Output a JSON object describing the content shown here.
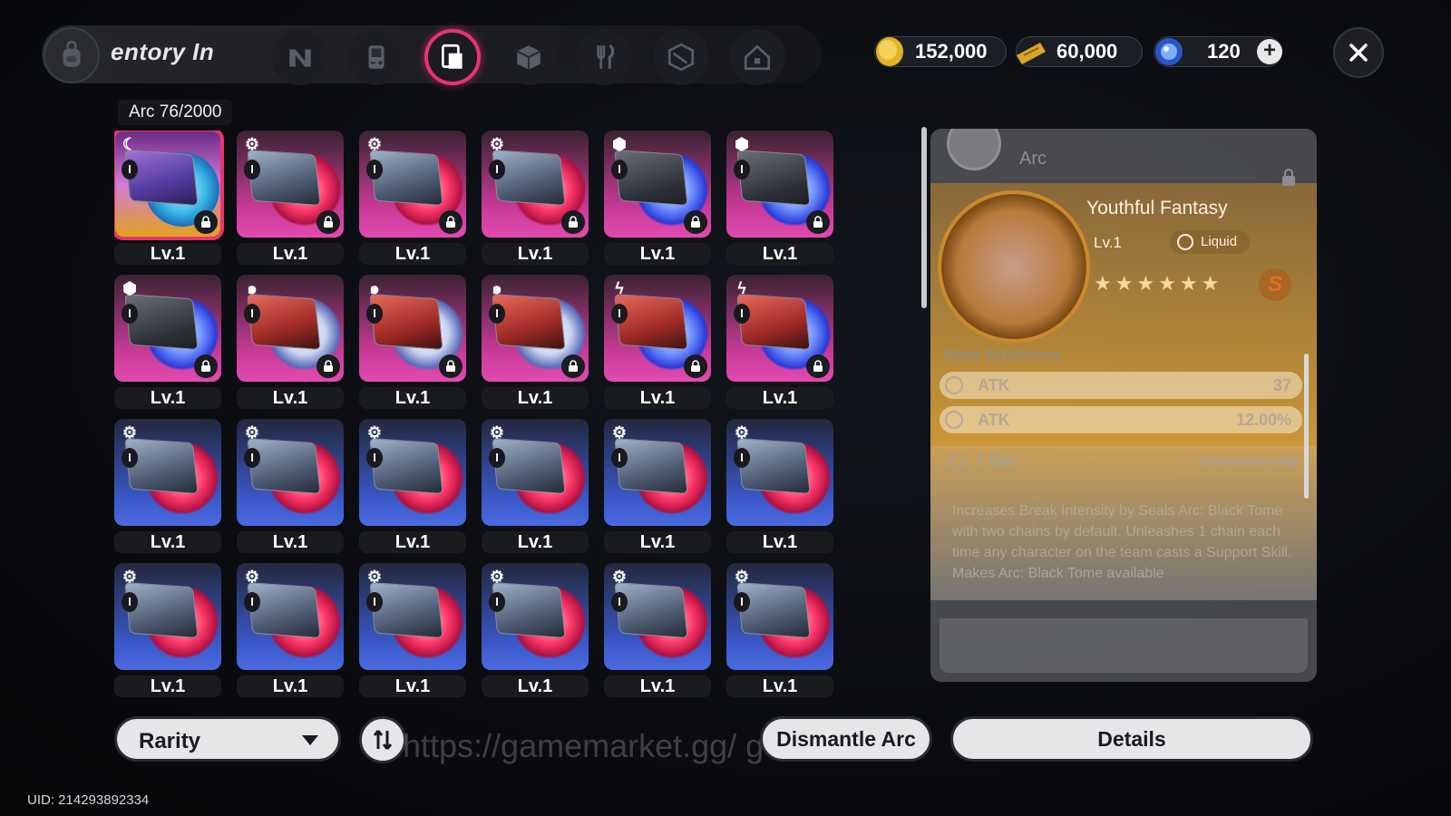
{
  "header": {
    "title": "entory  In",
    "tabs": [
      {
        "icon": "n-logo-icon",
        "active": false
      },
      {
        "icon": "handheld-console-icon",
        "active": false
      },
      {
        "icon": "arc-card-icon",
        "active": true
      },
      {
        "icon": "cube-icon",
        "active": false
      },
      {
        "icon": "fork-knife-icon",
        "active": false
      },
      {
        "icon": "box-open-icon",
        "active": false
      },
      {
        "icon": "house-icon",
        "active": false
      }
    ]
  },
  "currencies": [
    {
      "icon": "gold-coin-icon",
      "value": "152,000"
    },
    {
      "icon": "ticket-icon",
      "value": "60,000"
    },
    {
      "icon": "crystal-icon",
      "value": "120"
    }
  ],
  "inventory": {
    "category_count": "Arc 76/2000",
    "items": [
      {
        "lv": "Lv.1",
        "rarity": "gold",
        "art": "purple",
        "type": "wind-icon",
        "tier": "I",
        "locked": true,
        "selected": true
      },
      {
        "lv": "Lv.1",
        "rarity": "pink",
        "art": "slate",
        "type": "gear-icon",
        "tier": "I",
        "locked": true
      },
      {
        "lv": "Lv.1",
        "rarity": "pink",
        "art": "slate",
        "type": "gear-icon",
        "tier": "I",
        "locked": true
      },
      {
        "lv": "Lv.1",
        "rarity": "pink",
        "art": "slate",
        "type": "gear-icon",
        "tier": "I",
        "locked": true
      },
      {
        "lv": "Lv.1",
        "rarity": "pink",
        "art": "gray",
        "type": "cube-icon",
        "tier": "I",
        "locked": true
      },
      {
        "lv": "Lv.1",
        "rarity": "pink",
        "art": "gray",
        "type": "cube-icon",
        "tier": "I",
        "locked": true
      },
      {
        "lv": "Lv.1",
        "rarity": "pink",
        "art": "gray",
        "type": "cube-icon",
        "tier": "I",
        "locked": true
      },
      {
        "lv": "Lv.1",
        "rarity": "pink",
        "art": "red",
        "type": "swirl-icon",
        "tier": "I",
        "locked": true
      },
      {
        "lv": "Lv.1",
        "rarity": "pink",
        "art": "red",
        "type": "swirl-icon",
        "tier": "I",
        "locked": true
      },
      {
        "lv": "Lv.1",
        "rarity": "pink",
        "art": "red",
        "type": "swirl-icon",
        "tier": "I",
        "locked": true
      },
      {
        "lv": "Lv.1",
        "rarity": "pink",
        "art": "red",
        "type": "lightning-icon",
        "tier": "I",
        "locked": true
      },
      {
        "lv": "Lv.1",
        "rarity": "pink",
        "art": "red",
        "type": "lightning-icon",
        "tier": "I",
        "locked": true
      },
      {
        "lv": "Lv.1",
        "rarity": "blue",
        "art": "slate",
        "type": "gear-icon",
        "tier": "I",
        "locked": false
      },
      {
        "lv": "Lv.1",
        "rarity": "blue",
        "art": "slate",
        "type": "gear-icon",
        "tier": "I",
        "locked": false
      },
      {
        "lv": "Lv.1",
        "rarity": "blue",
        "art": "slate",
        "type": "gear-icon",
        "tier": "I",
        "locked": false
      },
      {
        "lv": "Lv.1",
        "rarity": "blue",
        "art": "slate",
        "type": "gear-icon",
        "tier": "I",
        "locked": false
      },
      {
        "lv": "Lv.1",
        "rarity": "blue",
        "art": "slate",
        "type": "gear-icon",
        "tier": "I",
        "locked": false
      },
      {
        "lv": "Lv.1",
        "rarity": "blue",
        "art": "slate",
        "type": "gear-icon",
        "tier": "I",
        "locked": false
      },
      {
        "lv": "Lv.1",
        "rarity": "blue",
        "art": "slate",
        "type": "gear-icon",
        "tier": "I",
        "locked": false
      },
      {
        "lv": "Lv.1",
        "rarity": "blue",
        "art": "slate",
        "type": "gear-icon",
        "tier": "I",
        "locked": false
      },
      {
        "lv": "Lv.1",
        "rarity": "blue",
        "art": "slate",
        "type": "gear-icon",
        "tier": "I",
        "locked": false
      },
      {
        "lv": "Lv.1",
        "rarity": "blue",
        "art": "slate",
        "type": "gear-icon",
        "tier": "I",
        "locked": false
      },
      {
        "lv": "Lv.1",
        "rarity": "blue",
        "art": "slate",
        "type": "gear-icon",
        "tier": "I",
        "locked": false
      },
      {
        "lv": "Lv.1",
        "rarity": "blue",
        "art": "slate",
        "type": "gear-icon",
        "tier": "I",
        "locked": false
      }
    ]
  },
  "detail": {
    "category": "Arc",
    "name": "Youthful Fantasy",
    "level": "Lv.1",
    "type_label": "Liquid",
    "stars": "★★★★★★",
    "rank_badge": "S",
    "main_attributes_title": "Main Attributes",
    "attributes": [
      {
        "name": "ATK",
        "value": "37"
      },
      {
        "name": "ATK",
        "value": "12.00%"
      }
    ],
    "tier_label": "I Tier",
    "tier_note": "characters only",
    "description": "Increases Break Intensity by\nSeals Arc: Black Tome with two chains by default. Unleashes 1 chain each time any character on the team casts a Support Skill. Makes Arc: Black Tome available"
  },
  "footer": {
    "sort_label": "Rarity",
    "dismantle_label": "Dismantle Arc",
    "details_label": "Details",
    "watermark": "https://gamemarket.gg/          gdohn",
    "uid": "UID: 214293892334"
  },
  "colors": {
    "accent": "#e8336f",
    "rarity_gold": "#e3a21c",
    "rarity_pink": "#e24ab0",
    "rarity_blue": "#4a6ae0"
  }
}
